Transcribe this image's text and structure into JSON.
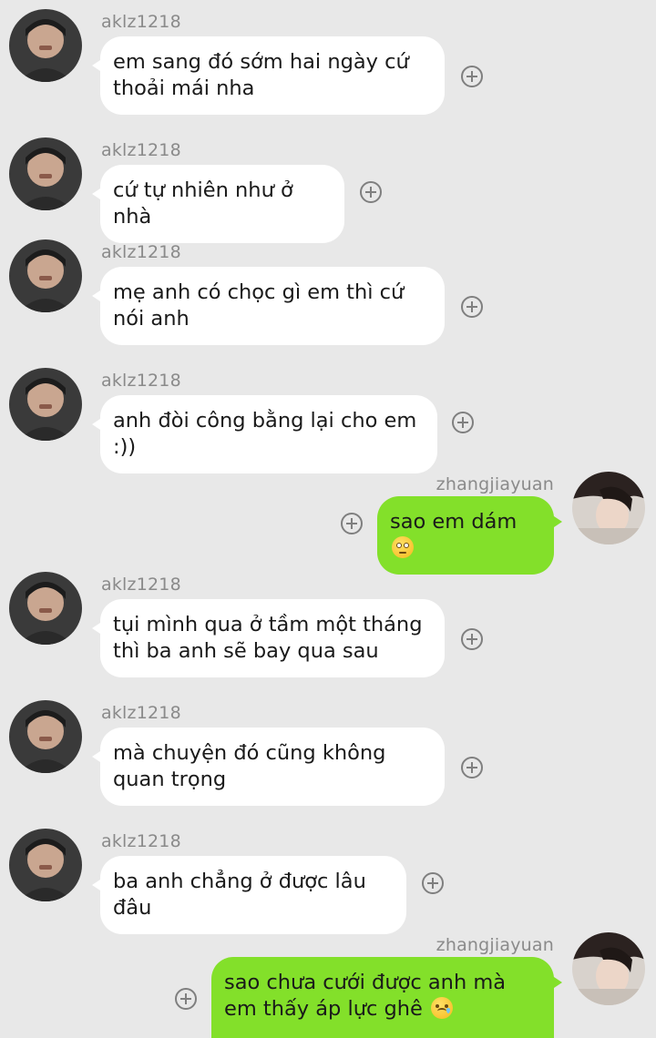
{
  "conversation": {
    "messages": [
      {
        "sender": "aklz1218",
        "text": "em sang đó sớm hai ngày cứ thoải mái nha"
      },
      {
        "sender": "aklz1218",
        "text": "cứ tự nhiên như ở nhà"
      },
      {
        "sender": "aklz1218",
        "text": "mẹ anh có chọc gì em thì cứ nói anh"
      },
      {
        "sender": "aklz1218",
        "text": "anh đòi công bằng lại cho em :))"
      },
      {
        "sender": "zhangjiayuan",
        "text": "sao em dám",
        "emoji": "rolling-eyes-emoji"
      },
      {
        "sender": "aklz1218",
        "text": "tụi mình qua ở tầm một tháng thì ba anh sẽ bay qua sau"
      },
      {
        "sender": "aklz1218",
        "text": "mà chuyện đó cũng không quan trọng"
      },
      {
        "sender": "aklz1218",
        "text": "ba anh chẳng ở được lâu đâu"
      },
      {
        "sender": "zhangjiayuan",
        "text": "sao chưa cưới được anh mà em thấy áp lực ghê",
        "emoji": "sad-tear-emoji"
      }
    ]
  },
  "colors": {
    "background": "#e8e8e8",
    "incoming_bubble": "#ffffff",
    "outgoing_bubble": "#83e02a",
    "sender_name": "#8a8a8a"
  },
  "icons": {
    "add_reaction": "plus-circle-icon"
  }
}
